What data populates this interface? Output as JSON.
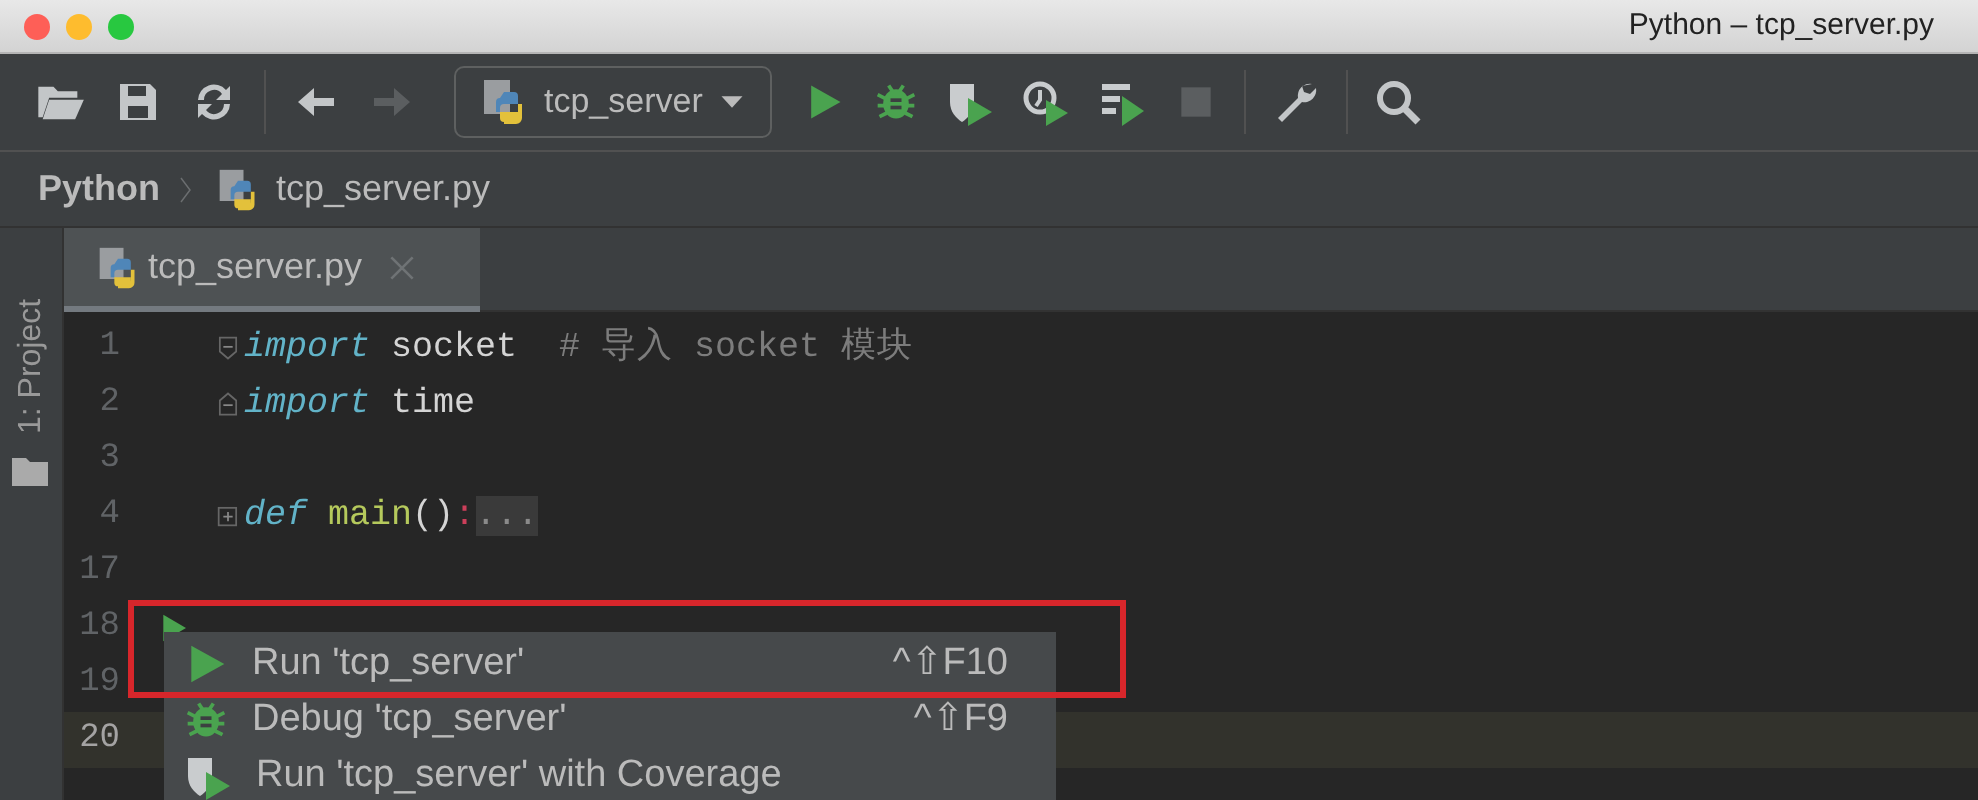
{
  "window": {
    "title": "Python – tcp_server.py"
  },
  "toolbar": [
    [
      {
        "kind": "open",
        "disabled": false
      },
      {
        "kind": "save",
        "disabled": false
      },
      {
        "kind": "sync",
        "disabled": false
      }
    ],
    [
      {
        "kind": "back",
        "disabled": false
      },
      {
        "kind": "forward",
        "disabled": true
      }
    ],
    [
      {
        "kind": "config",
        "label": "tcp_server",
        "disabled": false
      },
      {
        "kind": "run",
        "disabled": false
      },
      {
        "kind": "debug",
        "disabled": false
      },
      {
        "kind": "coverage",
        "disabled": false
      },
      {
        "kind": "profile",
        "disabled": false
      },
      {
        "kind": "concurrency",
        "disabled": false
      },
      {
        "kind": "stop",
        "disabled": true
      }
    ],
    [
      {
        "kind": "wrench",
        "disabled": false
      }
    ],
    [
      {
        "kind": "search",
        "disabled": false
      }
    ]
  ],
  "breadcrumb": [
    {
      "kind": "root",
      "label": "Python"
    },
    {
      "kind": "file",
      "label": "tcp_server.py"
    }
  ],
  "tool_window": {
    "label": "1: Project"
  },
  "tabs": [
    {
      "label": "tcp_server.py",
      "selected": true
    }
  ],
  "editor": {
    "lines": [
      {
        "number": "1",
        "fold": {
          "kind": "start"
        },
        "run": false,
        "current": false,
        "tokens": [
          {
            "kind": "keyword",
            "text": "import"
          },
          {
            "kind": "plain",
            "text": " socket  "
          },
          {
            "kind": "comment",
            "text": "# 导入 socket 模块"
          }
        ]
      },
      {
        "number": "2",
        "fold": {
          "kind": "end"
        },
        "run": false,
        "current": false,
        "tokens": [
          {
            "kind": "keyword",
            "text": "import"
          },
          {
            "kind": "plain",
            "text": " time"
          }
        ]
      },
      {
        "number": "3",
        "run": false,
        "current": false
      },
      {
        "number": "4",
        "fold": {
          "kind": "collapsed"
        },
        "run": false,
        "current": false,
        "tokens": [
          {
            "kind": "keyword",
            "text": "def "
          },
          {
            "kind": "func",
            "text": "main"
          },
          {
            "kind": "plain",
            "text": "()"
          },
          {
            "kind": "colon",
            "text": ":"
          },
          {
            "kind": "folded",
            "text": "..."
          }
        ]
      },
      {
        "number": "17",
        "run": false,
        "current": false
      },
      {
        "number": "18",
        "run": true,
        "current": false
      },
      {
        "number": "19",
        "run": false,
        "current": false
      },
      {
        "number": "20",
        "run": false,
        "current": true
      }
    ]
  },
  "popup": {
    "items": [
      {
        "kind": "run",
        "label": "Run 'tcp_server'",
        "shortcut": "^⇧F10"
      },
      {
        "kind": "debug",
        "label": "Debug 'tcp_server'",
        "shortcut": "^⇧F9"
      },
      {
        "kind": "coverage",
        "label": "Run 'tcp_server' with Coverage"
      }
    ]
  },
  "highlight_box": true
}
